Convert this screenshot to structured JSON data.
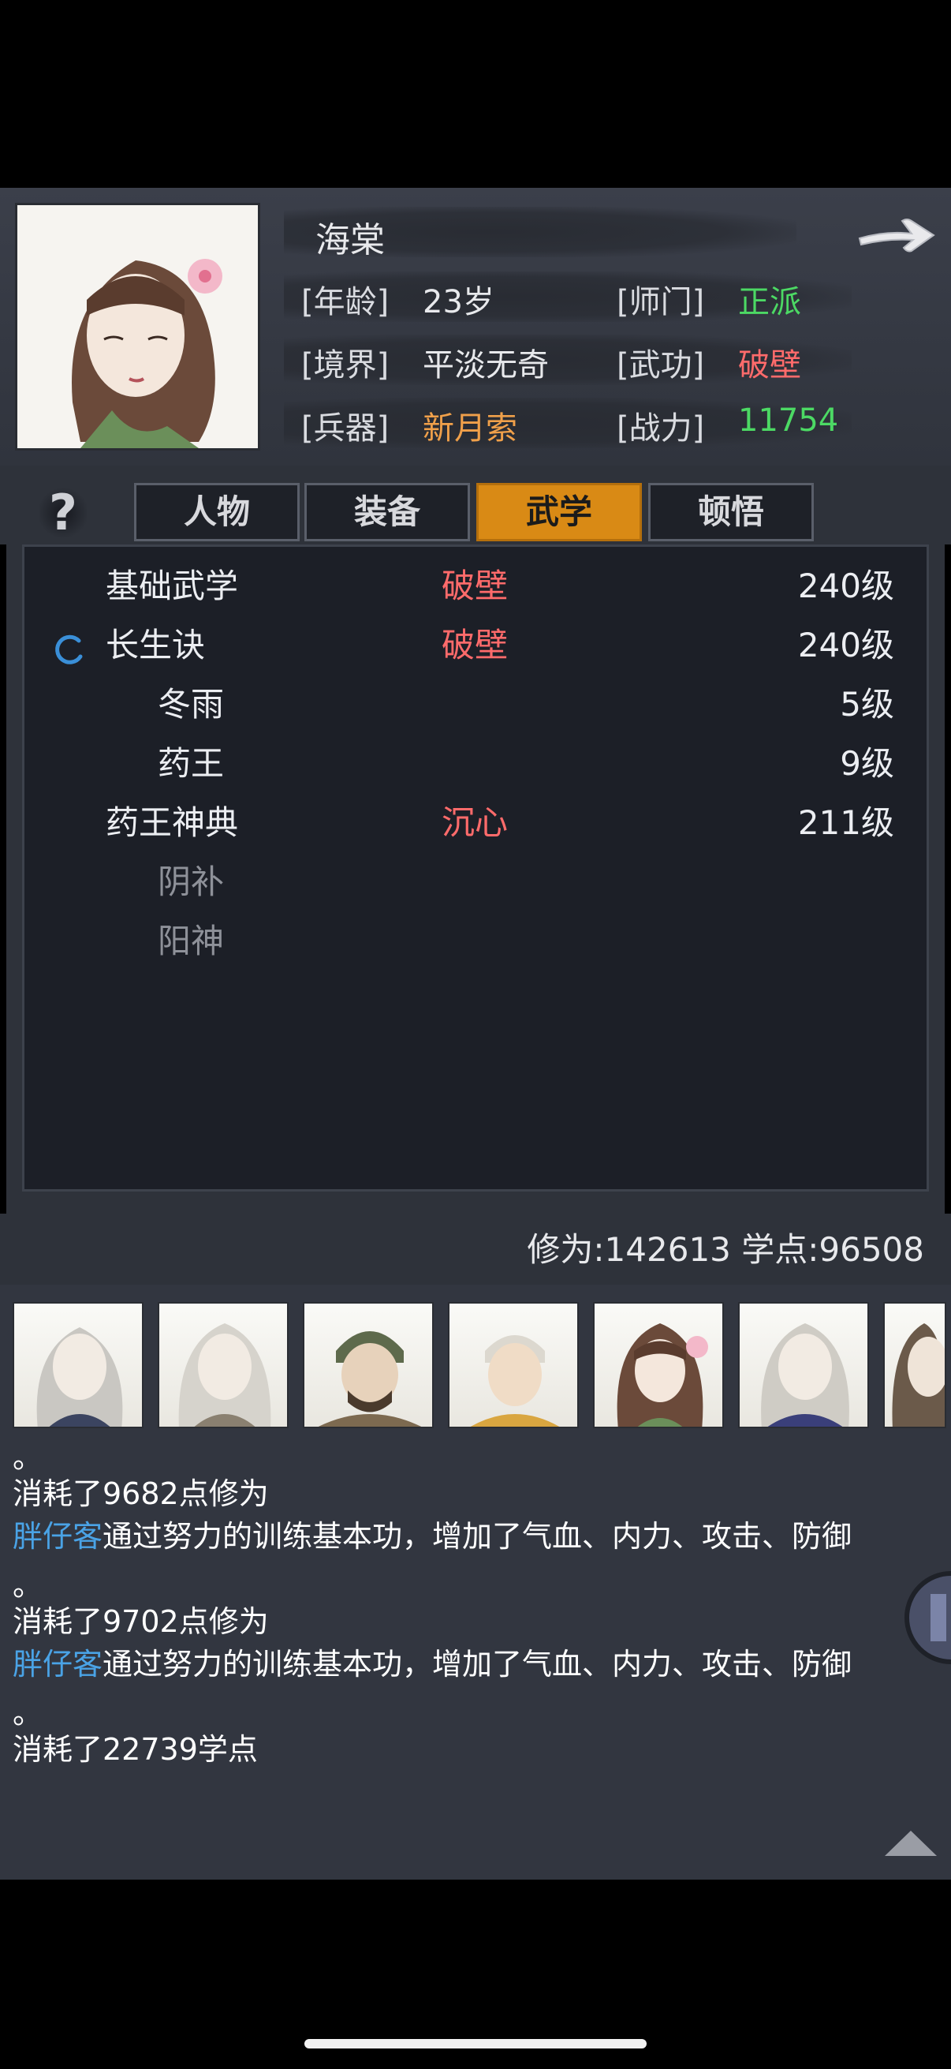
{
  "character": {
    "name": "海棠",
    "attrs": {
      "age": {
        "label": "[年龄]",
        "value": "23岁"
      },
      "sect": {
        "label": "[师门]",
        "value": "正派"
      },
      "realm": {
        "label": "[境界]",
        "value": "平淡无奇"
      },
      "martial": {
        "label": "[武功]",
        "value": "破壁"
      },
      "weapon": {
        "label": "[兵器]",
        "value": "新月索"
      },
      "power": {
        "label": "[战力]",
        "value": "11754"
      }
    }
  },
  "tabs": [
    {
      "label": "人物",
      "active": false
    },
    {
      "label": "装备",
      "active": false
    },
    {
      "label": "武学",
      "active": true
    },
    {
      "label": "顿悟",
      "active": false
    }
  ],
  "help_label": "?",
  "skills": [
    {
      "name": "基础武学",
      "tier": "破壁",
      "level": "240级"
    },
    {
      "name": "长生诀",
      "tier": "破壁",
      "level": "240级"
    },
    {
      "name": "冬雨",
      "tier": "",
      "level": "5级"
    },
    {
      "name": "药王",
      "tier": "",
      "level": "9级"
    },
    {
      "name": "药王神典",
      "tier": "沉心",
      "level": "211级"
    },
    {
      "name": "阴补",
      "tier": "",
      "level": ""
    },
    {
      "name": "阳神",
      "tier": "",
      "level": ""
    }
  ],
  "stats": {
    "text": "修为:142613  学点:96508"
  },
  "log": {
    "line1": "。",
    "line2": "消耗了9682点修为",
    "line3_name": "胖仔客",
    "line3_text": "通过努力的训练基本功，增加了气血、内力、攻击、防御",
    "line4": "。",
    "line5": "消耗了9702点修为",
    "line6_name": "胖仔客",
    "line6_text": "通过努力的训练基本功，增加了气血、内力、攻击、防御",
    "line7": "。",
    "line8": "消耗了22739学点"
  },
  "colors": {
    "accent_tab": "#d98a15",
    "green": "#4cd964",
    "red": "#ff6b6b",
    "orange": "#f0a04a",
    "link": "#4aa3e6"
  }
}
